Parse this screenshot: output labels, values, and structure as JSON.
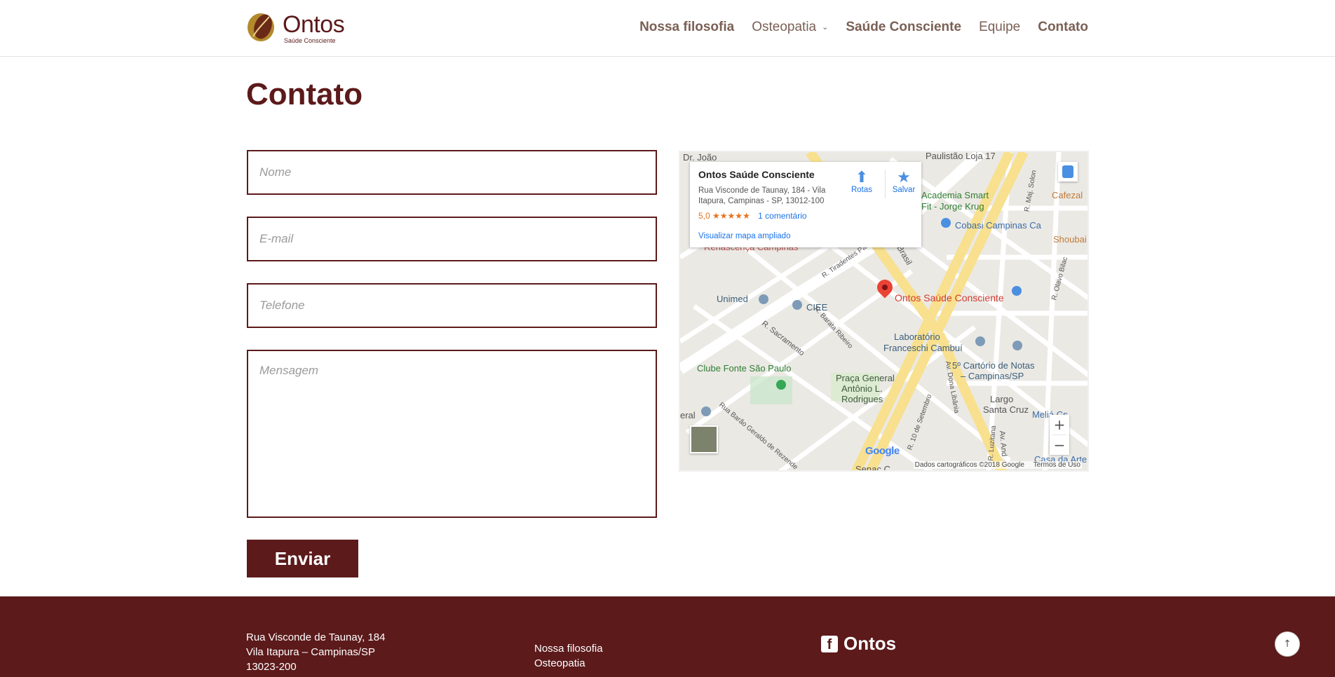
{
  "brand": {
    "name": "Ontos",
    "tagline": "Saúde Consciente"
  },
  "nav": {
    "items": [
      {
        "label": "Nossa filosofia"
      },
      {
        "label": "Osteopatia"
      },
      {
        "label": "Saúde Consciente"
      },
      {
        "label": "Equipe"
      },
      {
        "label": "Contato"
      }
    ],
    "dropdown_icon": "chevron-down-icon"
  },
  "page": {
    "title": "Contato"
  },
  "form": {
    "name_placeholder": "Nome",
    "email_placeholder": "E-mail",
    "phone_placeholder": "Telefone",
    "message_placeholder": "Mensagem",
    "submit_label": "Enviar"
  },
  "map": {
    "place_name": "Ontos Saúde Consciente",
    "address": "Rua Visconde de Taunay, 184 - Vila Itapura, Campinas - SP, 13012-100",
    "rating": "5,0",
    "stars": "★★★★★",
    "reviews": "1 comentário",
    "directions_label": "Rotas",
    "save_label": "Salvar",
    "larger_map_label": "Visualizar mapa ampliado",
    "pin_label": "Ontos Saúde Consciente",
    "attribution": "Dados cartográficos ©2018 Google",
    "terms": "Termos de Uso",
    "google_logo": "Google",
    "zoom_in": "+",
    "zoom_out": "−",
    "labels": {
      "unimed": "Unimed",
      "ciee": "CIEE",
      "clube": "Clube Fonte São Paulo",
      "academia1": "Academia Smart",
      "academia2": "Fit - Jorge Krug",
      "cobasi": "Cobasi Campinas Ca",
      "shoubai": "Shoubai",
      "cafezal": "Cafezal",
      "paulistao": "Paulistão Loja 17",
      "renascenca": "Renascença Campinas",
      "lab1": "Laboratório",
      "lab2": "Franceschi Cambuí",
      "cartorio1": "5º Cartório de Notas",
      "cartorio2": "– Campinas/SP",
      "praca1": "Praça General",
      "praca2": "Antônio L.",
      "praca3": "Rodrigues",
      "largo1": "Largo",
      "largo2": "Santa Cruz",
      "sacramento": "R. Sacramento",
      "barata": "R. Barata Ribeiro",
      "tiradentes": "R. Tiradentes Passos",
      "brasil": "Brasil",
      "joao": "Dr. João",
      "eral": "eral",
      "casa": "Casa da Arte",
      "melia": "Meliá Cs",
      "senac": "Senac C",
      "olavo": "R. Olavo Bilac",
      "libania": "Av. Dona Libânia",
      "setembro": "R. 10 de Setembro",
      "barao": "Rua Barão Geraldo de Rezende",
      "luzitana": "R. Luzitana",
      "solon": "R. Maj. Solon",
      "avand": "Av. And"
    },
    "colors": {
      "accent": "#ea4335",
      "link": "#1a73e8",
      "road_major": "#f8e08e"
    }
  },
  "footer": {
    "address_lines": [
      "Rua Visconde de Taunay, 184",
      "Vila Itapura – Campinas/SP",
      "13023-200"
    ],
    "links": [
      "Nossa filosofia",
      "Osteopatia"
    ],
    "facebook_label": "Ontos",
    "facebook_icon": "facebook-icon",
    "back_to_top": "↑"
  },
  "colors": {
    "brand": "#5c1a1b",
    "nav_text": "#7a6055"
  }
}
